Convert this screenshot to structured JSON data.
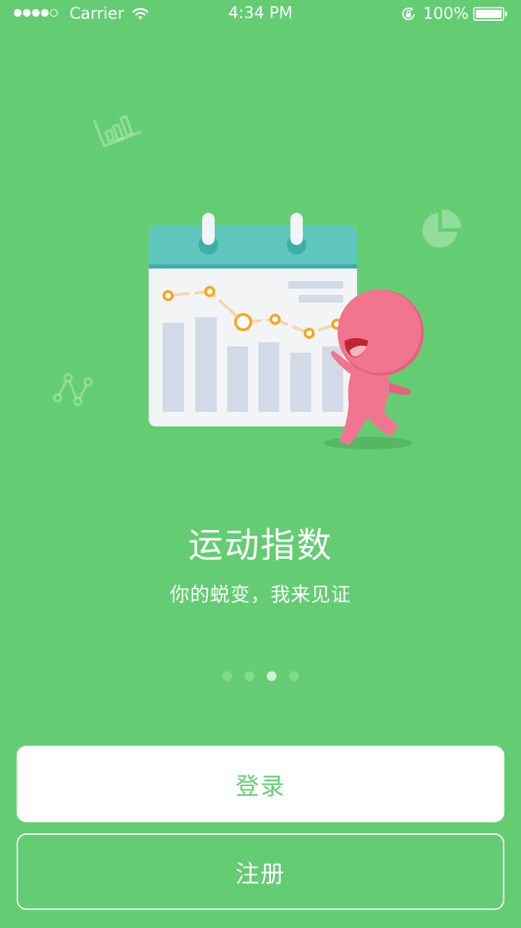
{
  "status_bar": {
    "carrier": "Carrier",
    "time": "4:34 PM",
    "battery": "100%",
    "signal_filled": 4,
    "signal_total": 5
  },
  "illustration": {
    "subject": "calendar-chart-with-pink-mascot"
  },
  "intro": {
    "title": "运动指数",
    "subtitle": "你的蜕变，我来见证"
  },
  "pager": {
    "count": 4,
    "active_index": 2
  },
  "actions": {
    "login_label": "登录",
    "register_label": "注册"
  },
  "colors": {
    "background": "#64CD73",
    "calendar_header": "#5EC6BC",
    "mascot": "#F27590",
    "chart_line": "#F5A623",
    "bars": "#D1DAE6"
  }
}
